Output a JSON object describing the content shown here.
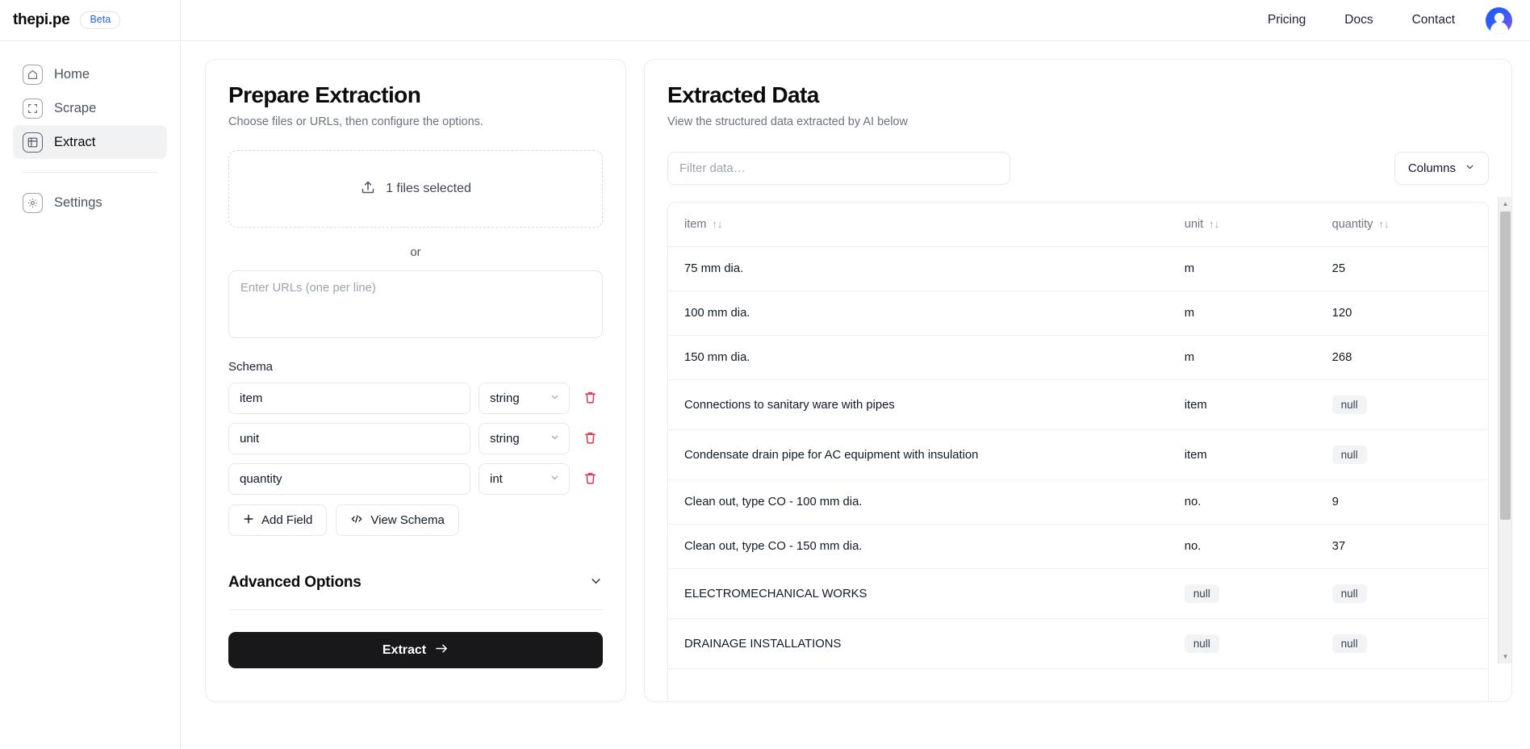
{
  "brand": {
    "name": "thepi.pe",
    "badge": "Beta"
  },
  "sidebar": {
    "items": [
      {
        "label": "Home",
        "icon": "home-icon",
        "active": false
      },
      {
        "label": "Scrape",
        "icon": "scrape-icon",
        "active": false
      },
      {
        "label": "Extract",
        "icon": "extract-icon",
        "active": true
      }
    ],
    "footer_items": [
      {
        "label": "Settings",
        "icon": "gear-icon",
        "active": false
      }
    ]
  },
  "header": {
    "links": [
      "Pricing",
      "Docs",
      "Contact"
    ],
    "avatar": "user-avatar"
  },
  "prepare": {
    "title": "Prepare Extraction",
    "subtitle": "Choose files or URLs, then configure the options.",
    "dropzone_label": "1 files selected",
    "or_label": "or",
    "urls_placeholder": "Enter URLs (one per line)",
    "urls_value": "",
    "schema_label": "Schema",
    "fields": [
      {
        "name": "item",
        "type": "string"
      },
      {
        "name": "unit",
        "type": "string"
      },
      {
        "name": "quantity",
        "type": "int"
      }
    ],
    "add_field_label": "Add Field",
    "view_schema_label": "View Schema",
    "advanced_label": "Advanced Options",
    "extract_label": "Extract"
  },
  "extracted": {
    "title": "Extracted Data",
    "subtitle": "View the structured data extracted by AI below",
    "filter_placeholder": "Filter data…",
    "filter_value": "",
    "columns_label": "Columns",
    "columns": [
      "item",
      "unit",
      "quantity"
    ],
    "rows": [
      {
        "item": "75 mm dia.",
        "unit": "m",
        "quantity": "25"
      },
      {
        "item": "100 mm dia.",
        "unit": "m",
        "quantity": "120"
      },
      {
        "item": "150 mm dia.",
        "unit": "m",
        "quantity": "268"
      },
      {
        "item": "Connections to sanitary ware with pipes",
        "unit": "item",
        "quantity": "null"
      },
      {
        "item": "Condensate drain pipe for AC equipment with insulation",
        "unit": "item",
        "quantity": "null"
      },
      {
        "item": "Clean out, type CO - 100 mm dia.",
        "unit": "no.",
        "quantity": "9"
      },
      {
        "item": "Clean out, type CO - 150 mm dia.",
        "unit": "no.",
        "quantity": "37"
      },
      {
        "item": "ELECTROMECHANICAL WORKS",
        "unit": "null",
        "quantity": "null"
      },
      {
        "item": "DRAINAGE INSTALLATIONS",
        "unit": "null",
        "quantity": "null"
      }
    ]
  },
  "colors": {
    "accent": "#2563eb",
    "avatar_start": "#1f5cf5",
    "avatar_end": "#8b52f0",
    "danger": "#e0354a",
    "button_dark": "#18181b",
    "active_nav_bg": "#f1f2f4"
  }
}
